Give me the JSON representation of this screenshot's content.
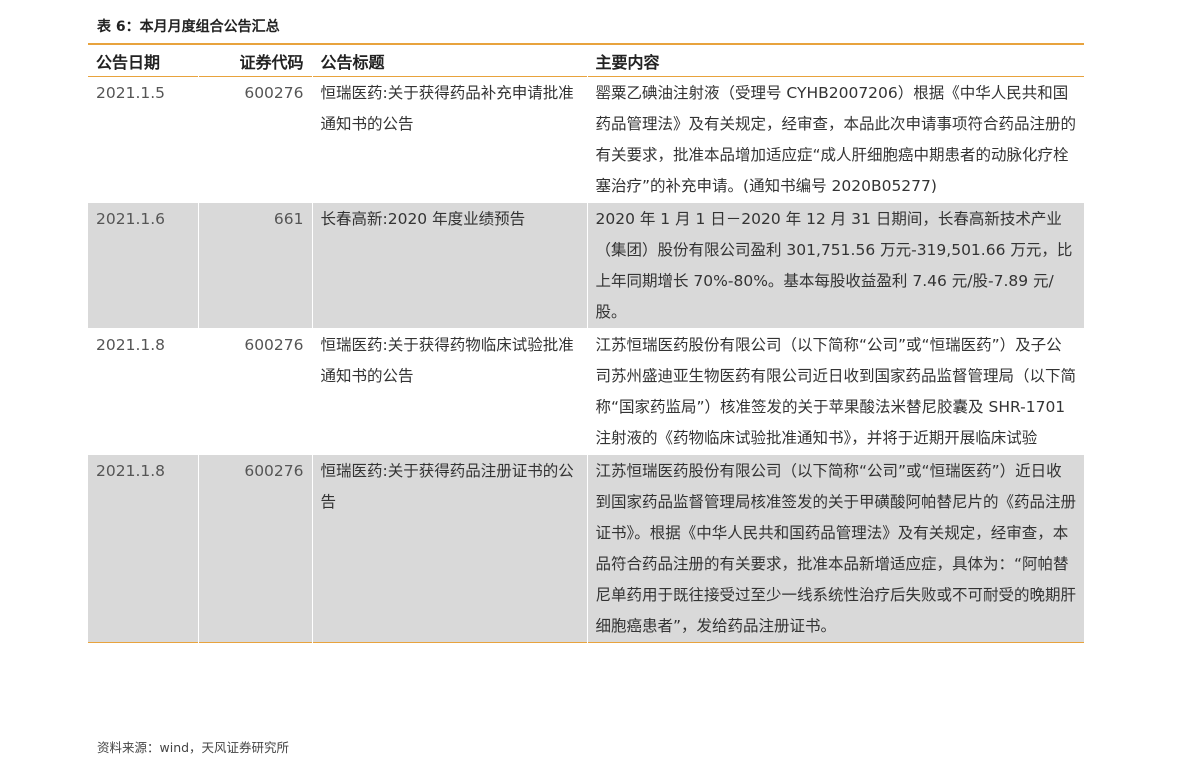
{
  "table": {
    "title": "表 6：本月月度组合公告汇总",
    "headers": {
      "date": "公告日期",
      "code": "证券代码",
      "title": "公告标题",
      "content": "主要内容"
    },
    "rows": [
      {
        "date": "2021.1.5",
        "code": "600276",
        "title": "恒瑞医药:关于获得药品补充申请批准通知书的公告",
        "content": "罂粟乙碘油注射液（受理号 CYHB2007206）根据《中华人民共和国药品管理法》及有关规定，经审查，本品此次申请事项符合药品注册的有关要求，批准本品增加适应症“成人肝细胞癌中期患者的动脉化疗栓塞治疗”的补充申请。(通知书编号 2020B05277)"
      },
      {
        "date": "2021.1.6",
        "code": "661",
        "title": "长春高新:2020 年度业绩预告",
        "content": "2020 年 1 月 1 日－2020 年 12 月 31 日期间，长春高新技术产业（集团）股份有限公司盈利 301,751.56 万元-319,501.66 万元，比上年同期增长 70%-80%。基本每股收益盈利 7.46 元/股-7.89 元/股。"
      },
      {
        "date": "2021.1.8",
        "code": "600276",
        "title": "恒瑞医药:关于获得药物临床试验批准通知书的公告",
        "content": "江苏恒瑞医药股份有限公司（以下简称“公司”或“恒瑞医药”）及子公司苏州盛迪亚生物医药有限公司近日收到国家药品监督管理局（以下简称“国家药监局”）核准签发的关于苹果酸法米替尼胶囊及 SHR-1701 注射液的《药物临床试验批准通知书》，并将于近期开展临床试验"
      },
      {
        "date": "2021.1.8",
        "code": "600276",
        "title": "恒瑞医药:关于获得药品注册证书的公告",
        "content": "江苏恒瑞医药股份有限公司（以下简称“公司”或“恒瑞医药”）近日收到国家药品监督管理局核准签发的关于甲磺酸阿帕替尼片的《药品注册证书》。根据《中华人民共和国药品管理法》及有关规定，经审查，本品符合药品注册的有关要求，批准本品新增适应症，具体为：“阿帕替尼单药用于既往接受过至少一线系统性治疗后失败或不可耐受的晚期肝细胞癌患者”，发给药品注册证书。"
      }
    ],
    "source": "资料来源：wind，天风证券研究所"
  },
  "colors": {
    "accent_border": "#e8a33d",
    "shaded_row": "#d9d9d9"
  }
}
